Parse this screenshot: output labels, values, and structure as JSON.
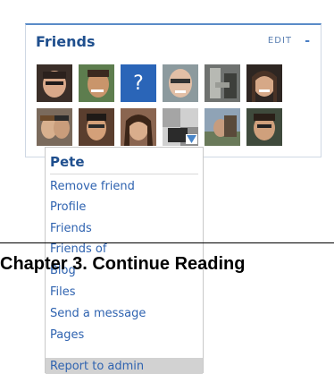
{
  "widget": {
    "title": "Friends",
    "edit_label": "EDIT",
    "collapse_glyph": "-",
    "avatars": [
      {
        "name": "avatar-1"
      },
      {
        "name": "avatar-2"
      },
      {
        "name": "avatar-3-placeholder",
        "glyph": "?"
      },
      {
        "name": "avatar-4"
      },
      {
        "name": "avatar-5"
      },
      {
        "name": "avatar-6"
      },
      {
        "name": "avatar-7"
      },
      {
        "name": "avatar-8"
      },
      {
        "name": "avatar-9"
      },
      {
        "name": "avatar-10-pete"
      },
      {
        "name": "avatar-11"
      },
      {
        "name": "avatar-12"
      }
    ]
  },
  "menu": {
    "name": "Pete",
    "items": [
      "Remove friend",
      "Profile",
      "Friends",
      "Friends of",
      "Blog",
      "Files",
      "Send a message",
      "Pages"
    ],
    "report": "Report to admin"
  },
  "chapter": {
    "text": "Chapter 3.  Continue Reading"
  },
  "colors": {
    "accent": "#1f4f8e",
    "link": "#2f63b0",
    "placeholder": "#2a65b8"
  }
}
